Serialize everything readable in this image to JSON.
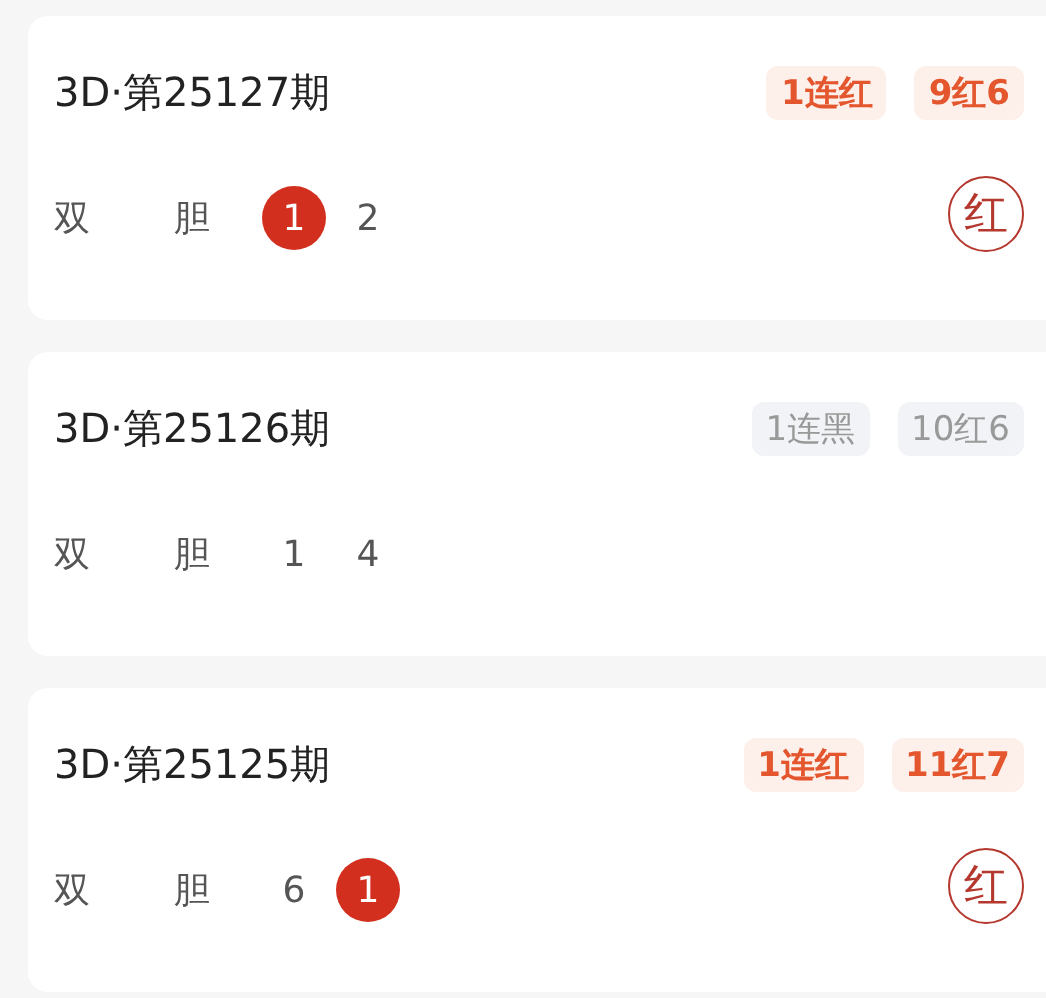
{
  "draws": [
    {
      "title": "3D·第25127期",
      "badges": [
        {
          "text": "1连红",
          "kind": "red"
        },
        {
          "text": "9红6",
          "kind": "red"
        }
      ],
      "labels": [
        "双",
        "胆"
      ],
      "numbers": [
        {
          "text": "1",
          "hit": true
        },
        {
          "text": "2",
          "hit": false
        }
      ],
      "stamp": "红"
    },
    {
      "title": "3D·第25126期",
      "badges": [
        {
          "text": "1连黑",
          "kind": "black"
        },
        {
          "text": "10红6",
          "kind": "black"
        }
      ],
      "labels": [
        "双",
        "胆"
      ],
      "numbers": [
        {
          "text": "1",
          "hit": false
        },
        {
          "text": "4",
          "hit": false
        }
      ]
    },
    {
      "title": "3D·第25125期",
      "badges": [
        {
          "text": "1连红",
          "kind": "red"
        },
        {
          "text": "11红7",
          "kind": "red"
        }
      ],
      "labels": [
        "双",
        "胆"
      ],
      "numbers": [
        {
          "text": "6",
          "hit": false
        },
        {
          "text": "1",
          "hit": true
        }
      ],
      "stamp": "红"
    }
  ]
}
